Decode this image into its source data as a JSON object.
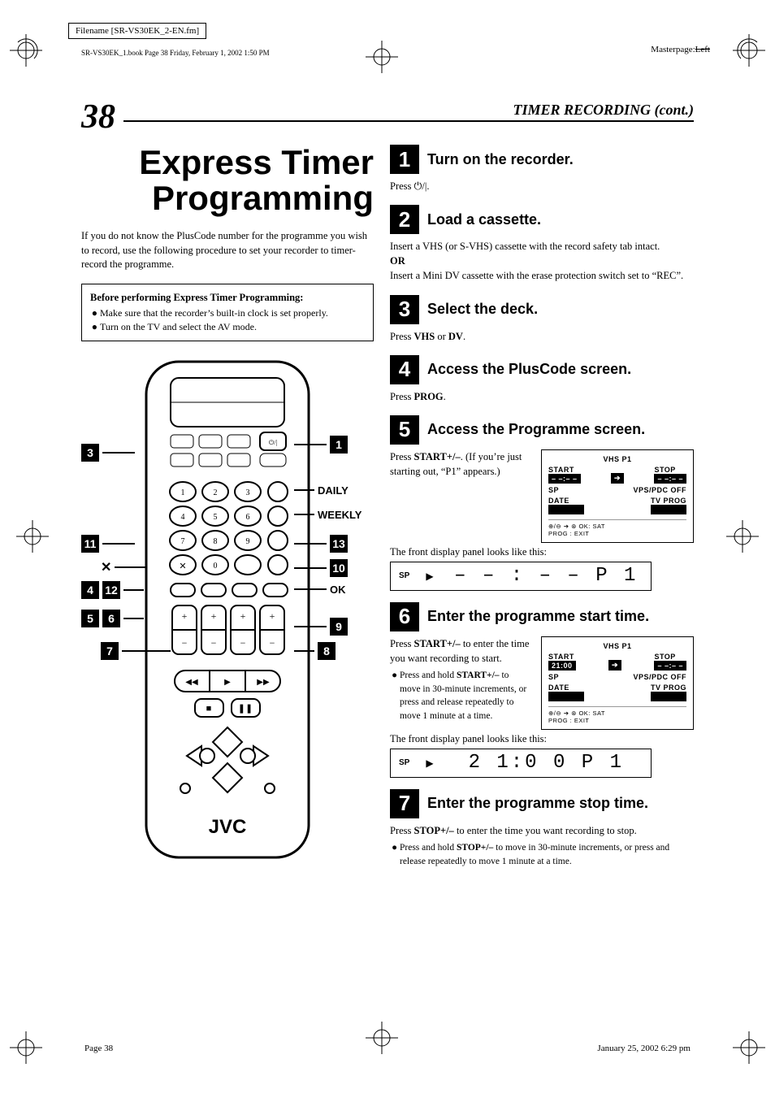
{
  "meta": {
    "filename": "Filename [SR-VS30EK_2-EN.fm]",
    "bookline": "SR-VS30EK_1.book  Page 38  Friday, February 1, 2002  1:50 PM",
    "masterpage_label": "Masterpage:",
    "masterpage_value": "Left",
    "footer_left": "Page 38",
    "footer_right": "January 25, 2002  6:29 pm"
  },
  "header": {
    "page_number": "38",
    "section_title": "TIMER RECORDING (cont.)"
  },
  "left": {
    "title": "Express Timer Programming",
    "intro": "If you do not know the PlusCode number for the programme you wish to record, use the following procedure to set your recorder to timer-record the programme.",
    "before_title": "Before performing Express Timer Programming:",
    "before_items": [
      "Make sure that the recorder’s built-in clock is set properly.",
      "Turn on the TV and select the AV mode."
    ],
    "callouts": {
      "c1": "1",
      "c3": "3",
      "c4": "4",
      "c5": "5",
      "c6": "6",
      "c7": "7",
      "c8": "8",
      "c9": "9",
      "c10": "10",
      "c11": "11",
      "c12": "12",
      "c13": "13",
      "daily": "DAILY",
      "weekly": "WEEKLY",
      "ok": "OK",
      "x": "✕"
    },
    "brand": "JVC"
  },
  "steps": {
    "s1": {
      "num": "1",
      "title": "Turn on the recorder.",
      "body": "Press ⏻/|."
    },
    "s2": {
      "num": "2",
      "title": "Load a cassette.",
      "body1": "Insert a VHS (or S-VHS) cassette with the record safety tab intact.",
      "or": "OR",
      "body2": "Insert a Mini DV cassette with the erase protection switch set to “REC”."
    },
    "s3": {
      "num": "3",
      "title": "Select the deck.",
      "body": "Press VHS or DV."
    },
    "s4": {
      "num": "4",
      "title": "Access the PlusCode screen.",
      "body": "Press PROG."
    },
    "s5": {
      "num": "5",
      "title": "Access the Programme screen.",
      "body": "Press START+/–. (If you’re just starting out, “P1” appears.)",
      "caption": "The front display panel looks like this:",
      "osd": {
        "head": "VHS   P1",
        "start_label": "START",
        "start_val": "– –:– –",
        "arrow": "➔",
        "stop_label": "STOP",
        "stop_val": "– –:– –",
        "sp": "SP",
        "vpspdc": "VPS/PDC OFF",
        "date_label": "DATE",
        "tvprog_label": "TV PROG",
        "bottom": "⊕/⊖ ➔ ⊛    OK: SAT",
        "bottom2": "PROG : EXIT"
      },
      "display": {
        "sp": "SP",
        "seg": "– – : – –   P 1"
      }
    },
    "s6": {
      "num": "6",
      "title": "Enter the programme start time.",
      "body": "Press START+/– to enter the time you want recording to start.",
      "bullet": "Press and hold START+/– to move in 30-minute increments, or press and release repeatedly to move 1 minute at a time.",
      "caption": "The front display panel looks like this:",
      "osd": {
        "head": "VHS   P1",
        "start_label": "START",
        "start_val": "21:00",
        "arrow": "➔",
        "stop_label": "STOP",
        "stop_val": "– –:– –",
        "sp": "SP",
        "vpspdc": "VPS/PDC OFF",
        "date_label": "DATE",
        "tvprog_label": "TV PROG",
        "bottom": "⊕/⊖ ➔ ⊛    OK: SAT",
        "bottom2": "PROG : EXIT"
      },
      "display": {
        "sp": "SP",
        "seg": "2 1:0 0  P 1"
      }
    },
    "s7": {
      "num": "7",
      "title": "Enter the programme stop time.",
      "body": "Press STOP+/– to enter the time you want recording to stop.",
      "bullet": "Press and hold STOP+/– to move in 30-minute increments, or press and release repeatedly to move 1 minute at a time."
    }
  }
}
